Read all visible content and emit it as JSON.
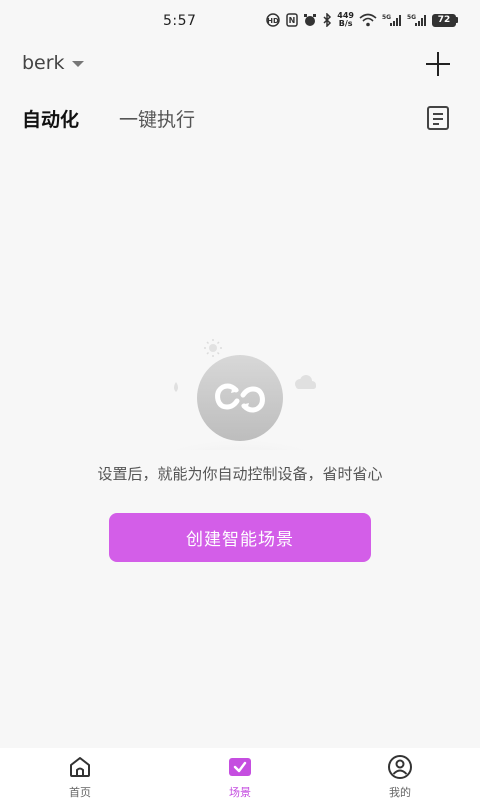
{
  "status_bar": {
    "time": "5:57",
    "net_speed_value": "449",
    "net_speed_unit": "B/s",
    "signal_1_label": "5G",
    "signal_2_label": "5G",
    "battery": "72"
  },
  "header": {
    "home_name": "berk"
  },
  "tabs": [
    {
      "label": "自动化",
      "active": true
    },
    {
      "label": "一键执行",
      "active": false
    }
  ],
  "empty_state": {
    "message": "设置后，就能为你自动控制设备，省时省心",
    "button_label": "创建智能场景"
  },
  "bottom_nav": [
    {
      "label": "首页",
      "icon": "home-icon",
      "active": false
    },
    {
      "label": "场景",
      "icon": "scene-icon",
      "active": true
    },
    {
      "label": "我的",
      "icon": "profile-icon",
      "active": false
    }
  ],
  "colors": {
    "accent": "#d35ee8",
    "background": "#f7f7f7",
    "nav_active": "#c54ee0"
  }
}
